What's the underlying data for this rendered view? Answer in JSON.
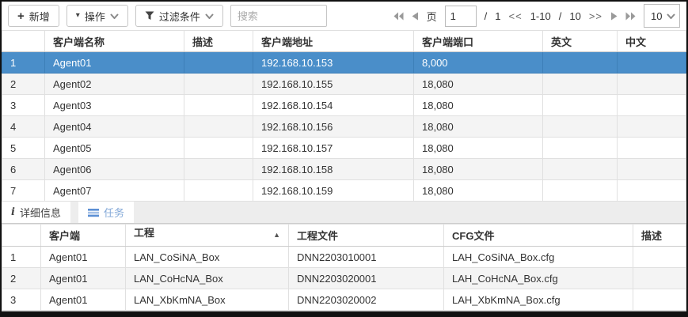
{
  "toolbar": {
    "add_label": "新增",
    "action_label": "操作",
    "filter_label": "过滤条件",
    "search_placeholder": "搜索"
  },
  "pagination": {
    "page_label": "页",
    "page_value": "1",
    "sep": "/",
    "total_pages": "1",
    "range_prev": "<<",
    "range_text": "1-10",
    "range_sep": "/",
    "total_items": "10",
    "range_next": ">>",
    "page_size": "10"
  },
  "clients_table": {
    "columns": [
      "客户端名称",
      "描述",
      "客户端地址",
      "客户端端口",
      "英文",
      "中文"
    ],
    "rows": [
      {
        "num": "1",
        "name": "Agent01",
        "desc": "",
        "addr": "192.168.10.153",
        "port": "8,000",
        "en": "",
        "zh": "",
        "selected": true
      },
      {
        "num": "2",
        "name": "Agent02",
        "desc": "",
        "addr": "192.168.10.155",
        "port": "18,080",
        "en": "",
        "zh": ""
      },
      {
        "num": "3",
        "name": "Agent03",
        "desc": "",
        "addr": "192.168.10.154",
        "port": "18,080",
        "en": "",
        "zh": ""
      },
      {
        "num": "4",
        "name": "Agent04",
        "desc": "",
        "addr": "192.168.10.156",
        "port": "18,080",
        "en": "",
        "zh": ""
      },
      {
        "num": "5",
        "name": "Agent05",
        "desc": "",
        "addr": "192.168.10.157",
        "port": "18,080",
        "en": "",
        "zh": ""
      },
      {
        "num": "6",
        "name": "Agent06",
        "desc": "",
        "addr": "192.168.10.158",
        "port": "18,080",
        "en": "",
        "zh": ""
      },
      {
        "num": "7",
        "name": "Agent07",
        "desc": "",
        "addr": "192.168.10.159",
        "port": "18,080",
        "en": "",
        "zh": ""
      }
    ]
  },
  "tabs": [
    {
      "label": "详细信息",
      "active": false
    },
    {
      "label": "任务",
      "active": true
    }
  ],
  "tasks_table": {
    "columns": [
      "客户端",
      "工程",
      "工程文件",
      "CFG文件",
      "描述"
    ],
    "sort_icon": "▲",
    "rows": [
      {
        "num": "1",
        "client": "Agent01",
        "project": "LAN_CoSiNA_Box",
        "project_file": "DNN2203010001",
        "cfg_file": "LAH_CoSiNA_Box.cfg",
        "desc": ""
      },
      {
        "num": "2",
        "client": "Agent01",
        "project": "LAN_CoHcNA_Box",
        "project_file": "DNN2203020001",
        "cfg_file": "LAH_CoHcNA_Box.cfg",
        "desc": ""
      },
      {
        "num": "3",
        "client": "Agent01",
        "project": "LAN_XbKmNA_Box",
        "project_file": "DNN2203020002",
        "cfg_file": "LAH_XbKmNA_Box.cfg",
        "desc": ""
      }
    ]
  },
  "colors": {
    "selected_row": "#4a8ec9",
    "stripe": "#f4f4f4",
    "tab_active_text": "#84a9d8"
  }
}
